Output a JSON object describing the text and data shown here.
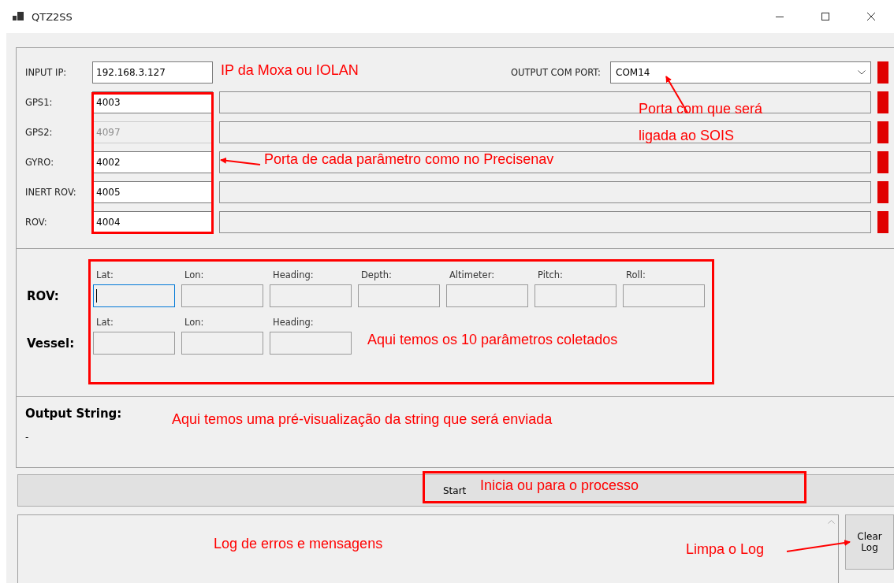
{
  "window": {
    "title": "QTZ2SS"
  },
  "connection": {
    "input_ip": {
      "label": "INPUT IP:",
      "value": "192.168.3.127"
    },
    "output_com_port": {
      "label": "OUTPUT COM PORT:",
      "value": "COM14",
      "connected": false
    },
    "ports": [
      {
        "label": "GPS1:",
        "value": "4003",
        "disabled": false,
        "connected": false
      },
      {
        "label": "GPS2:",
        "value": "4097",
        "disabled": true,
        "connected": false
      },
      {
        "label": "GYRO:",
        "value": "4002",
        "disabled": false,
        "connected": false
      },
      {
        "label": "INERT ROV:",
        "value": "4005",
        "disabled": false,
        "connected": false
      },
      {
        "label": "ROV:",
        "value": "4004",
        "disabled": false,
        "connected": false
      }
    ]
  },
  "readings": [
    {
      "label": "ROV:",
      "fields": [
        {
          "label": "Lat:",
          "focused": true
        },
        {
          "label": "Lon:",
          "focused": false
        },
        {
          "label": "Heading:",
          "focused": false
        },
        {
          "label": "Depth:",
          "focused": false
        },
        {
          "label": "Altimeter:",
          "focused": false
        },
        {
          "label": "Pitch:",
          "focused": false
        },
        {
          "label": "Roll:",
          "focused": false
        }
      ]
    },
    {
      "label": "Vessel:",
      "fields": [
        {
          "label": "Lat:",
          "focused": false
        },
        {
          "label": "Lon:",
          "focused": false
        },
        {
          "label": "Heading:",
          "focused": false
        }
      ]
    }
  ],
  "output_string": {
    "label": "Output String:",
    "value": "-"
  },
  "start_button": "Start",
  "clear_log_button": "Clear Log",
  "annotations": [
    {
      "text": "IP da Moxa ou IOLAN",
      "kind": "plain"
    },
    {
      "text": "Porta de cada parâmetro como no Precisenav",
      "kind": "framed-arrow"
    },
    {
      "text": "Porta com que será ligada ao SOIS",
      "kind": "arrow"
    },
    {
      "text": "Aqui temos os 10 parâmetros coletados",
      "kind": "framed"
    },
    {
      "text": "Aqui temos uma pré-visualização da string que será enviada",
      "kind": "plain"
    },
    {
      "text": "Inicia ou para o processo",
      "kind": "framed"
    },
    {
      "text": "Log de erros e mensagens",
      "kind": "plain"
    },
    {
      "text": "Limpa o Log",
      "kind": "arrow"
    }
  ]
}
